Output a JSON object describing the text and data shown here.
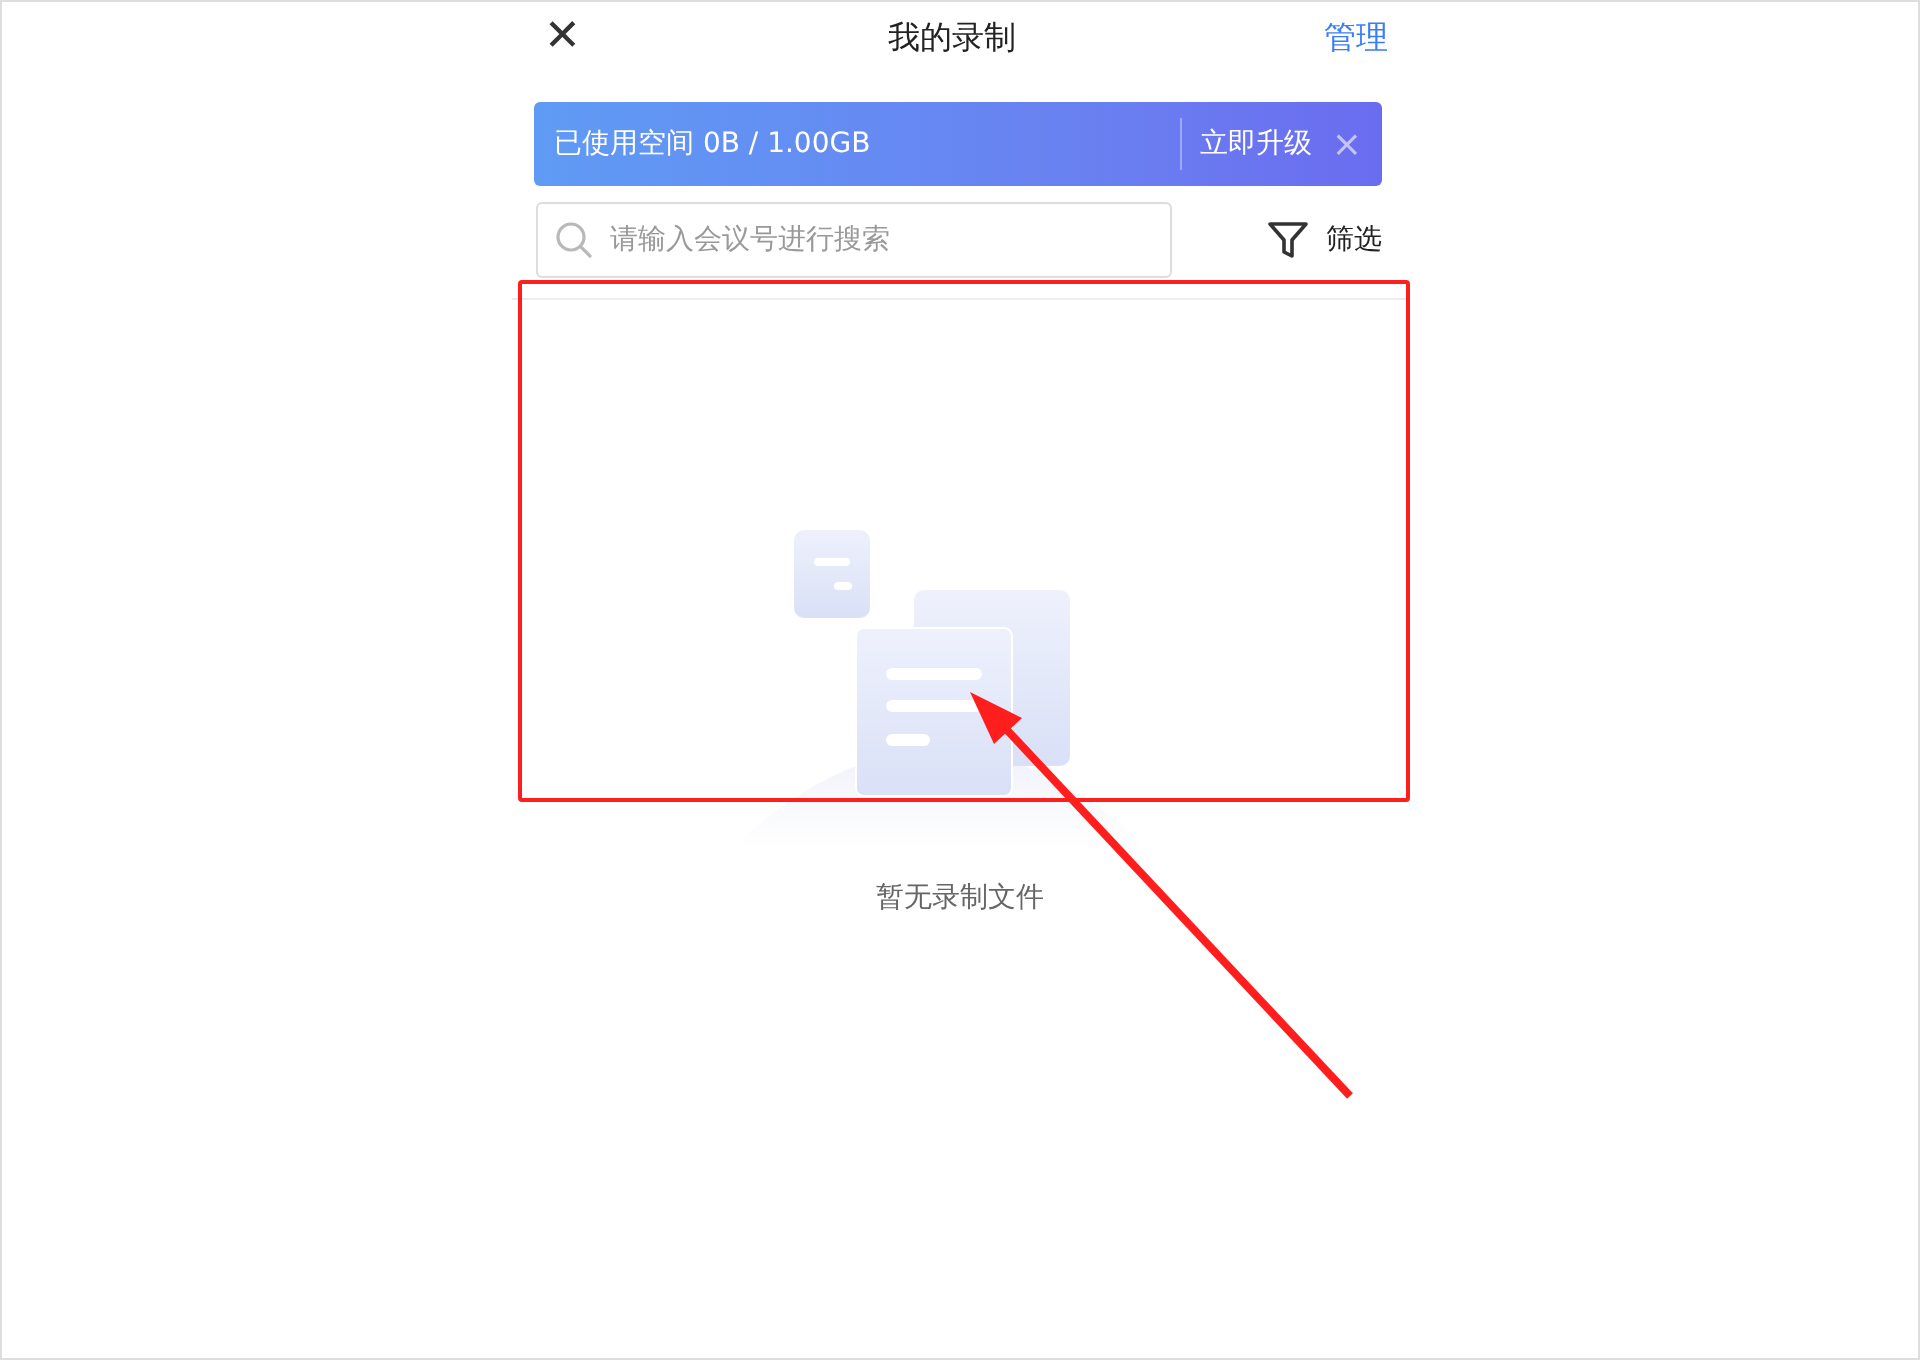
{
  "header": {
    "close_icon": "✕",
    "title": "我的录制",
    "action": "管理"
  },
  "storage_banner": {
    "text": "已使用空间 0B / 1.00GB",
    "upgrade": "立即升级",
    "dismiss": "×"
  },
  "search": {
    "placeholder": "请输入会议号进行搜索"
  },
  "filter": {
    "label": "筛选"
  },
  "empty_state": {
    "message": "暂无录制文件"
  }
}
